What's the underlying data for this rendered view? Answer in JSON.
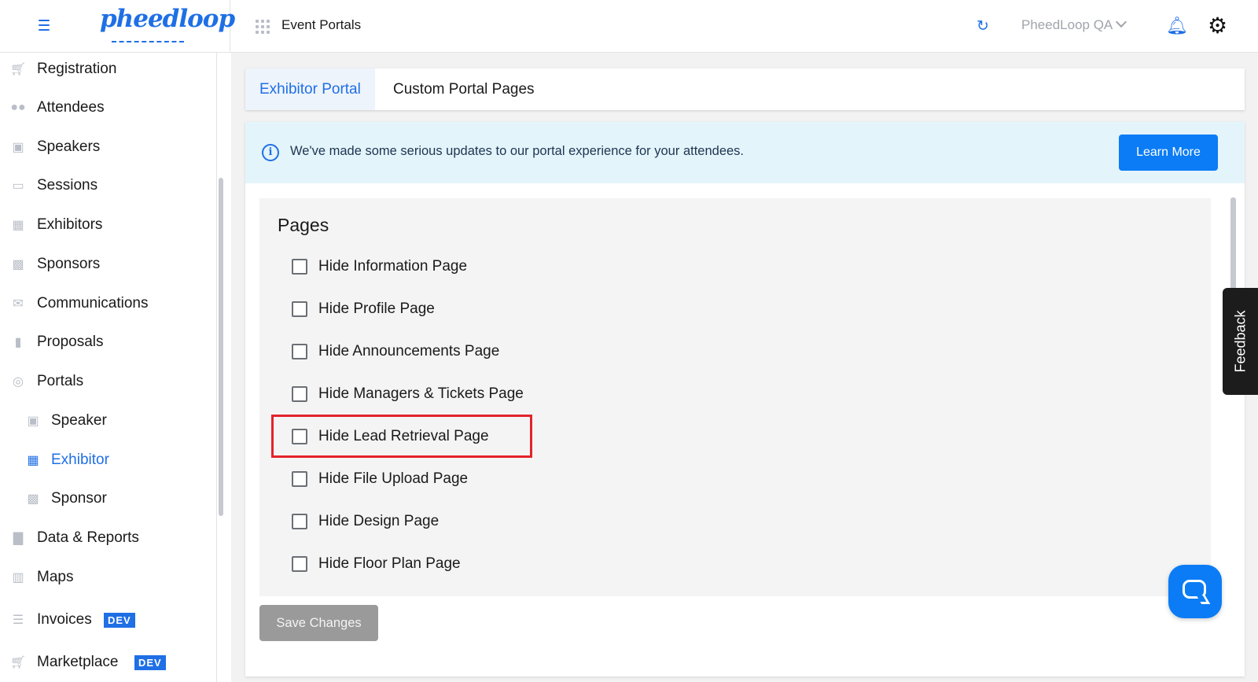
{
  "header": {
    "logo": "pheedloop",
    "event_title": "Event Portals",
    "account": "PheedLoop QA"
  },
  "sidebar": {
    "items": [
      {
        "label": "Registration",
        "icon": "cart-icon"
      },
      {
        "label": "Attendees",
        "icon": "people-icon"
      },
      {
        "label": "Speakers",
        "icon": "speaker-icon"
      },
      {
        "label": "Sessions",
        "icon": "laptop-icon"
      },
      {
        "label": "Exhibitors",
        "icon": "store-icon"
      },
      {
        "label": "Sponsors",
        "icon": "badge-icon"
      },
      {
        "label": "Communications",
        "icon": "mail-icon"
      },
      {
        "label": "Proposals",
        "icon": "file-icon"
      },
      {
        "label": "Portals",
        "icon": "globe-icon"
      }
    ],
    "subitems": [
      {
        "label": "Speaker",
        "icon": "speaker-icon"
      },
      {
        "label": "Exhibitor",
        "icon": "store-icon",
        "active": true
      },
      {
        "label": "Sponsor",
        "icon": "badge-icon"
      }
    ],
    "items2": [
      {
        "label": "Data & Reports",
        "icon": "chart-icon"
      },
      {
        "label": "Maps",
        "icon": "map-icon"
      },
      {
        "label": "Invoices",
        "icon": "invoice-icon",
        "badge": "DEV"
      },
      {
        "label": "Marketplace",
        "icon": "cart-icon",
        "badge": "DEV"
      }
    ]
  },
  "tabs": {
    "active": "Exhibitor Portal",
    "inactive": "Custom Portal Pages"
  },
  "banner": {
    "text": "We've made some serious updates to our portal experience for your attendees.",
    "button": "Learn More"
  },
  "pages": {
    "title": "Pages",
    "options": [
      {
        "label": "Hide Information Page",
        "checked": false
      },
      {
        "label": "Hide Profile Page",
        "checked": false
      },
      {
        "label": "Hide Announcements Page",
        "checked": false
      },
      {
        "label": "Hide Managers & Tickets Page",
        "checked": false
      },
      {
        "label": "Hide Lead Retrieval Page",
        "checked": false
      },
      {
        "label": "Hide File Upload Page",
        "checked": false
      },
      {
        "label": "Hide Design Page",
        "checked": false
      },
      {
        "label": "Hide Floor Plan Page",
        "checked": false
      }
    ]
  },
  "save_button": "Save Changes",
  "feedback": "Feedback",
  "colors": {
    "accent": "#1f6fe5",
    "button": "#0b7cf5",
    "highlight": "#e3232b",
    "banner_bg": "#e4f4fb"
  }
}
